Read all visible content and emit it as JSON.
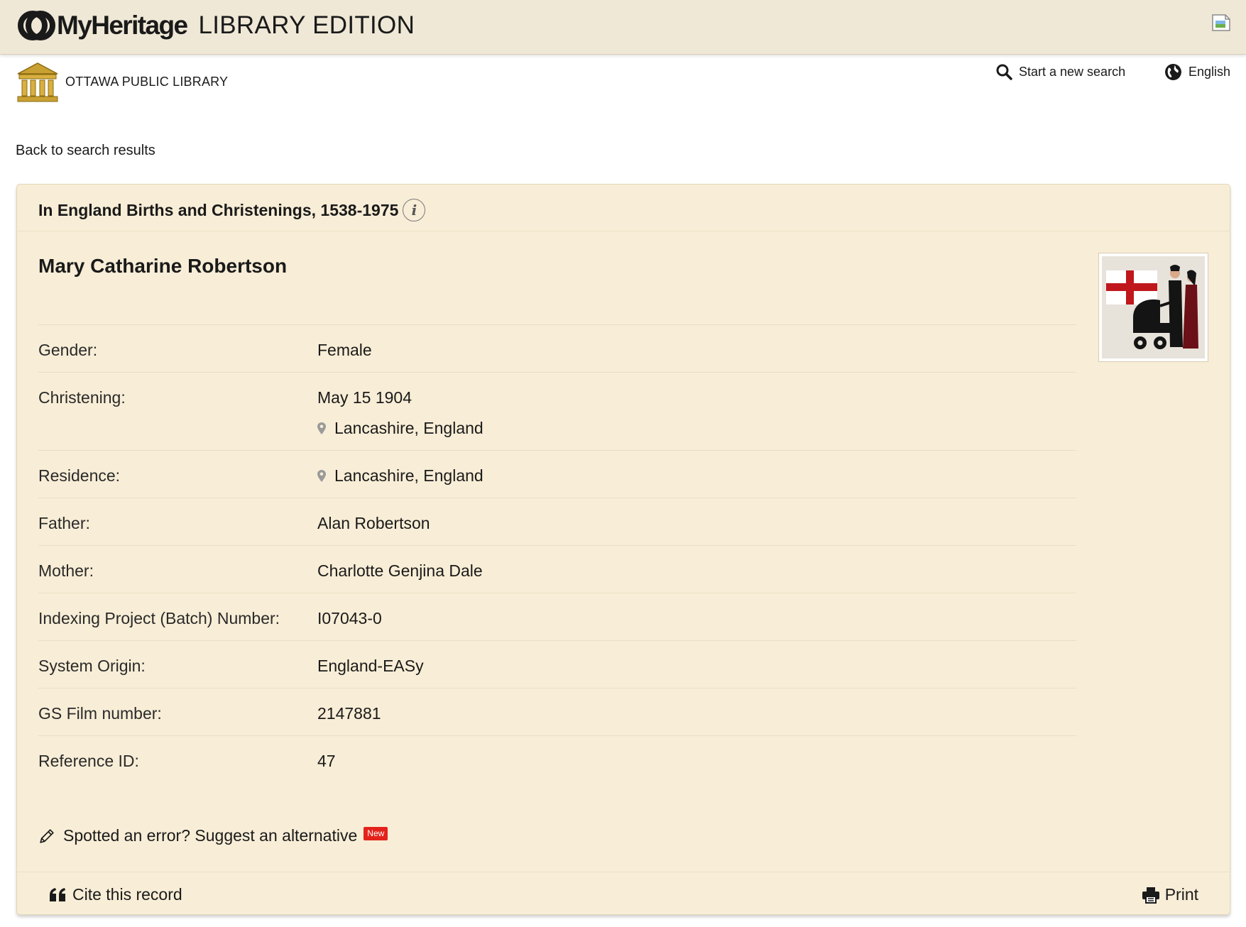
{
  "header": {
    "brand": "MyHeritage",
    "edition": "LIBRARY EDITION"
  },
  "library": {
    "name": "OTTAWA PUBLIC LIBRARY"
  },
  "nav": {
    "new_search": "Start a new search",
    "language": "English",
    "back": "Back to search results"
  },
  "record": {
    "collection": "In England Births and Christenings, 1538-1975",
    "info_glyph": "i",
    "name": "Mary Catharine Robertson",
    "fields": [
      {
        "label": "Gender:",
        "value": "Female"
      },
      {
        "label": "Christening:",
        "value": "May 15 1904",
        "place": "Lancashire, England"
      },
      {
        "label": "Residence:",
        "place": "Lancashire, England"
      },
      {
        "label": "Father:",
        "value": "Alan Robertson"
      },
      {
        "label": "Mother:",
        "value": "Charlotte Genjina Dale"
      },
      {
        "label": "Indexing Project (Batch) Number:",
        "value": "I07043-0"
      },
      {
        "label": "System Origin:",
        "value": "England-EASy"
      },
      {
        "label": "GS Film number:",
        "value": "2147881"
      },
      {
        "label": "Reference ID:",
        "value": "47"
      }
    ],
    "suggest": "Spotted an error? Suggest an alternative",
    "suggest_badge": "New"
  },
  "footer": {
    "cite": "Cite this record",
    "print": "Print"
  },
  "colors": {
    "header_bg": "#efe8d6",
    "card_bg": "#f8edd6",
    "badge_red": "#e3231b",
    "library_gold": "#c9a032"
  },
  "icons": [
    "myheritage-logo-icon",
    "broken-image-icon",
    "library-building-icon",
    "search-icon",
    "globe-icon",
    "info-icon",
    "location-pin-icon",
    "pencil-icon",
    "quote-icon",
    "printer-icon"
  ]
}
